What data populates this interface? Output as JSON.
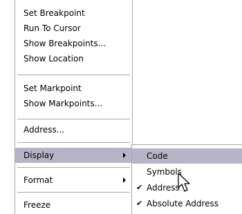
{
  "menu": {
    "items": [
      {
        "label": "Set Breakpoint"
      },
      {
        "label": "Run To Cursor"
      },
      {
        "label": "Show Breakpoints..."
      },
      {
        "label": "Show Location"
      },
      {
        "label": "Set Markpoint"
      },
      {
        "label": "Show Markpoints..."
      },
      {
        "label": "Address..."
      },
      {
        "label": "Display"
      },
      {
        "label": "Format"
      },
      {
        "label": "Freeze"
      }
    ]
  },
  "submenu": {
    "items": [
      {
        "label": "Code",
        "checked": false
      },
      {
        "label": "Symbols",
        "checked": false
      },
      {
        "label": "Address",
        "checked": true
      },
      {
        "label": "Absolute Address",
        "checked": true
      }
    ]
  },
  "colors": {
    "highlight": "#b7b4c8",
    "border": "#a7a6aa"
  },
  "icons": {
    "check": "✔",
    "submenu_arrow": "chevron-right-icon",
    "cursor": "mouse-pointer-icon"
  }
}
